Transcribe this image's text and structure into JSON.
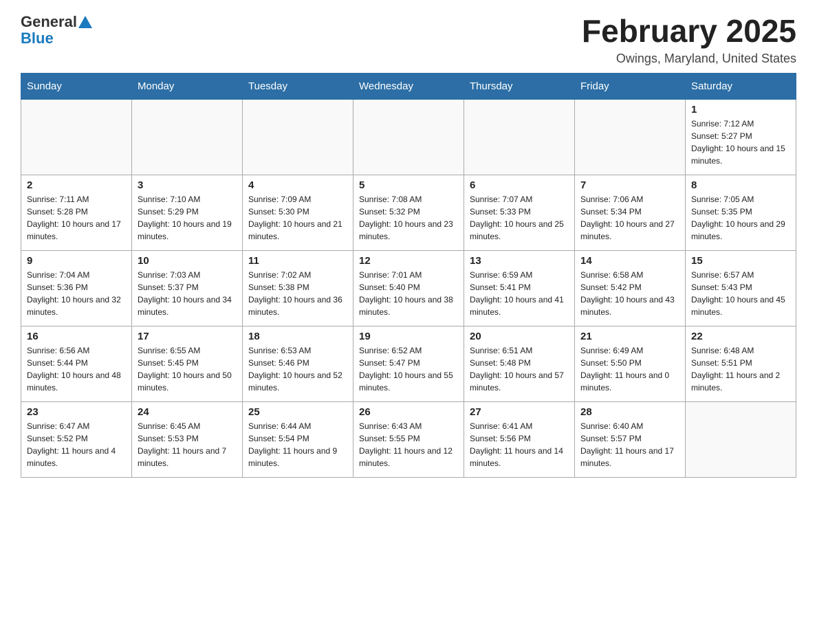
{
  "header": {
    "logo_general": "General",
    "logo_blue": "Blue",
    "month_title": "February 2025",
    "location": "Owings, Maryland, United States"
  },
  "days_of_week": [
    "Sunday",
    "Monday",
    "Tuesday",
    "Wednesday",
    "Thursday",
    "Friday",
    "Saturday"
  ],
  "weeks": [
    [
      {
        "day": "",
        "info": ""
      },
      {
        "day": "",
        "info": ""
      },
      {
        "day": "",
        "info": ""
      },
      {
        "day": "",
        "info": ""
      },
      {
        "day": "",
        "info": ""
      },
      {
        "day": "",
        "info": ""
      },
      {
        "day": "1",
        "info": "Sunrise: 7:12 AM\nSunset: 5:27 PM\nDaylight: 10 hours and 15 minutes."
      }
    ],
    [
      {
        "day": "2",
        "info": "Sunrise: 7:11 AM\nSunset: 5:28 PM\nDaylight: 10 hours and 17 minutes."
      },
      {
        "day": "3",
        "info": "Sunrise: 7:10 AM\nSunset: 5:29 PM\nDaylight: 10 hours and 19 minutes."
      },
      {
        "day": "4",
        "info": "Sunrise: 7:09 AM\nSunset: 5:30 PM\nDaylight: 10 hours and 21 minutes."
      },
      {
        "day": "5",
        "info": "Sunrise: 7:08 AM\nSunset: 5:32 PM\nDaylight: 10 hours and 23 minutes."
      },
      {
        "day": "6",
        "info": "Sunrise: 7:07 AM\nSunset: 5:33 PM\nDaylight: 10 hours and 25 minutes."
      },
      {
        "day": "7",
        "info": "Sunrise: 7:06 AM\nSunset: 5:34 PM\nDaylight: 10 hours and 27 minutes."
      },
      {
        "day": "8",
        "info": "Sunrise: 7:05 AM\nSunset: 5:35 PM\nDaylight: 10 hours and 29 minutes."
      }
    ],
    [
      {
        "day": "9",
        "info": "Sunrise: 7:04 AM\nSunset: 5:36 PM\nDaylight: 10 hours and 32 minutes."
      },
      {
        "day": "10",
        "info": "Sunrise: 7:03 AM\nSunset: 5:37 PM\nDaylight: 10 hours and 34 minutes."
      },
      {
        "day": "11",
        "info": "Sunrise: 7:02 AM\nSunset: 5:38 PM\nDaylight: 10 hours and 36 minutes."
      },
      {
        "day": "12",
        "info": "Sunrise: 7:01 AM\nSunset: 5:40 PM\nDaylight: 10 hours and 38 minutes."
      },
      {
        "day": "13",
        "info": "Sunrise: 6:59 AM\nSunset: 5:41 PM\nDaylight: 10 hours and 41 minutes."
      },
      {
        "day": "14",
        "info": "Sunrise: 6:58 AM\nSunset: 5:42 PM\nDaylight: 10 hours and 43 minutes."
      },
      {
        "day": "15",
        "info": "Sunrise: 6:57 AM\nSunset: 5:43 PM\nDaylight: 10 hours and 45 minutes."
      }
    ],
    [
      {
        "day": "16",
        "info": "Sunrise: 6:56 AM\nSunset: 5:44 PM\nDaylight: 10 hours and 48 minutes."
      },
      {
        "day": "17",
        "info": "Sunrise: 6:55 AM\nSunset: 5:45 PM\nDaylight: 10 hours and 50 minutes."
      },
      {
        "day": "18",
        "info": "Sunrise: 6:53 AM\nSunset: 5:46 PM\nDaylight: 10 hours and 52 minutes."
      },
      {
        "day": "19",
        "info": "Sunrise: 6:52 AM\nSunset: 5:47 PM\nDaylight: 10 hours and 55 minutes."
      },
      {
        "day": "20",
        "info": "Sunrise: 6:51 AM\nSunset: 5:48 PM\nDaylight: 10 hours and 57 minutes."
      },
      {
        "day": "21",
        "info": "Sunrise: 6:49 AM\nSunset: 5:50 PM\nDaylight: 11 hours and 0 minutes."
      },
      {
        "day": "22",
        "info": "Sunrise: 6:48 AM\nSunset: 5:51 PM\nDaylight: 11 hours and 2 minutes."
      }
    ],
    [
      {
        "day": "23",
        "info": "Sunrise: 6:47 AM\nSunset: 5:52 PM\nDaylight: 11 hours and 4 minutes."
      },
      {
        "day": "24",
        "info": "Sunrise: 6:45 AM\nSunset: 5:53 PM\nDaylight: 11 hours and 7 minutes."
      },
      {
        "day": "25",
        "info": "Sunrise: 6:44 AM\nSunset: 5:54 PM\nDaylight: 11 hours and 9 minutes."
      },
      {
        "day": "26",
        "info": "Sunrise: 6:43 AM\nSunset: 5:55 PM\nDaylight: 11 hours and 12 minutes."
      },
      {
        "day": "27",
        "info": "Sunrise: 6:41 AM\nSunset: 5:56 PM\nDaylight: 11 hours and 14 minutes."
      },
      {
        "day": "28",
        "info": "Sunrise: 6:40 AM\nSunset: 5:57 PM\nDaylight: 11 hours and 17 minutes."
      },
      {
        "day": "",
        "info": ""
      }
    ]
  ]
}
